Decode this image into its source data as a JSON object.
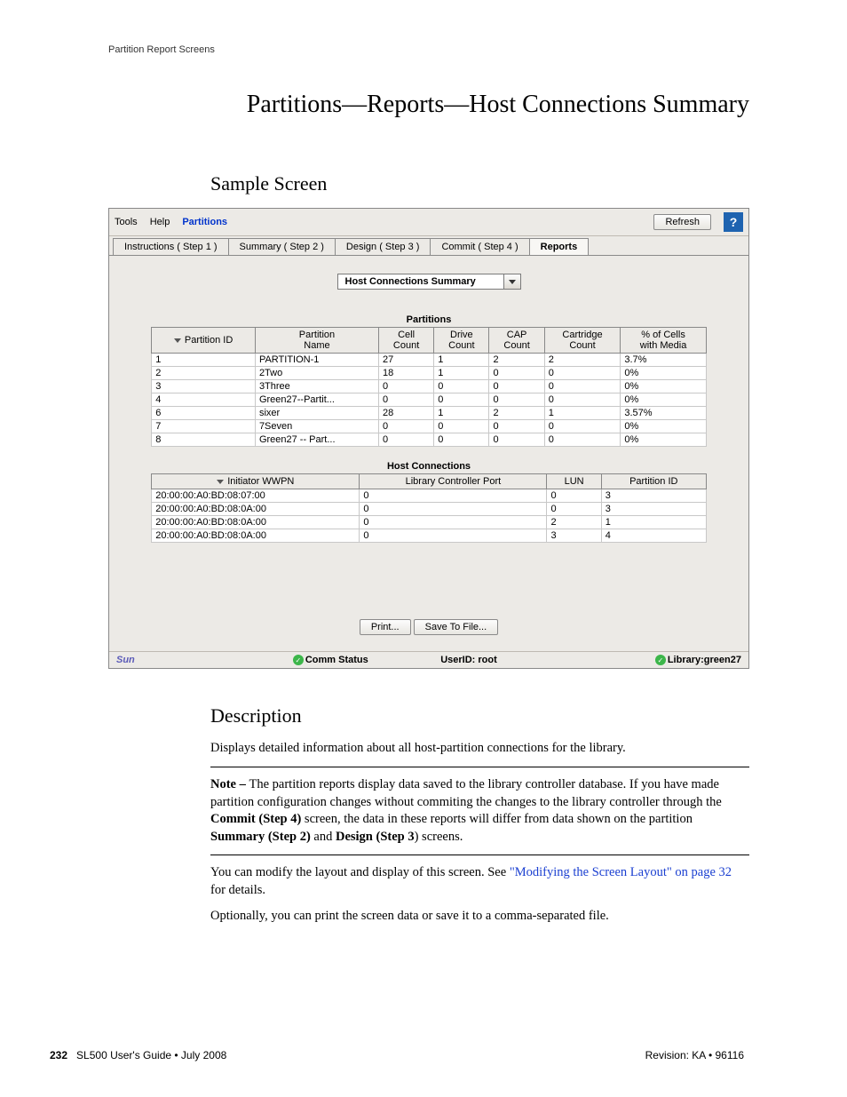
{
  "running_head": "Partition Report Screens",
  "title": "Partitions—Reports—Host Connections Summary",
  "section_sample": "Sample Screen",
  "section_desc": "Description",
  "menubar": {
    "tools": "Tools",
    "help": "Help",
    "partitions": "Partitions",
    "refresh": "Refresh",
    "help_icon": "?"
  },
  "tabs": {
    "step1": "Instructions ( Step 1 )",
    "step2": "Summary ( Step 2 )",
    "step3": "Design ( Step 3 )",
    "step4": "Commit ( Step 4 )",
    "reports": "Reports"
  },
  "dropdown": {
    "value": "Host Connections Summary"
  },
  "partitions_table": {
    "title": "Partitions",
    "headers": {
      "id": "Partition ID",
      "name": "Partition\nName",
      "cell": "Cell\nCount",
      "drive": "Drive\nCount",
      "cap": "CAP\nCount",
      "cart": "Cartridge\nCount",
      "pct": "% of Cells\nwith Media"
    },
    "rows": [
      {
        "id": "1",
        "name": "PARTITION-1",
        "cell": "27",
        "drive": "1",
        "cap": "2",
        "cart": "2",
        "pct": "3.7%"
      },
      {
        "id": "2",
        "name": "2Two",
        "cell": "18",
        "drive": "1",
        "cap": "0",
        "cart": "0",
        "pct": "0%"
      },
      {
        "id": "3",
        "name": "3Three",
        "cell": "0",
        "drive": "0",
        "cap": "0",
        "cart": "0",
        "pct": "0%"
      },
      {
        "id": "4",
        "name": "Green27--Partit...",
        "cell": "0",
        "drive": "0",
        "cap": "0",
        "cart": "0",
        "pct": "0%"
      },
      {
        "id": "6",
        "name": "sixer",
        "cell": "28",
        "drive": "1",
        "cap": "2",
        "cart": "1",
        "pct": "3.57%"
      },
      {
        "id": "7",
        "name": "7Seven",
        "cell": "0",
        "drive": "0",
        "cap": "0",
        "cart": "0",
        "pct": "0%"
      },
      {
        "id": "8",
        "name": "Green27 -- Part...",
        "cell": "0",
        "drive": "0",
        "cap": "0",
        "cart": "0",
        "pct": "0%"
      }
    ]
  },
  "hosts_table": {
    "title": "Host Connections",
    "headers": {
      "wwpn": "Initiator WWPN",
      "port": "Library Controller Port",
      "lun": "LUN",
      "pid": "Partition ID"
    },
    "rows": [
      {
        "wwpn": "20:00:00:A0:BD:08:07:00",
        "port": "0",
        "lun": "0",
        "pid": "3"
      },
      {
        "wwpn": "20:00:00:A0:BD:08:0A:00",
        "port": "0",
        "lun": "0",
        "pid": "3"
      },
      {
        "wwpn": "20:00:00:A0:BD:08:0A:00",
        "port": "0",
        "lun": "2",
        "pid": "1"
      },
      {
        "wwpn": "20:00:00:A0:BD:08:0A:00",
        "port": "0",
        "lun": "3",
        "pid": "4"
      }
    ]
  },
  "actions": {
    "print": "Print...",
    "save": "Save To File..."
  },
  "statusbar": {
    "logo": "Sun",
    "comm": "Comm Status",
    "user": "UserID: root",
    "library": "Library:green27"
  },
  "description": {
    "p1": "Displays detailed information about all host-partition connections for the library.",
    "note_prefix": "Note – ",
    "note_body_1": "The partition reports display data saved to the library controller database. If you have made partition configuration changes without commiting the changes to the library controller through the ",
    "note_b1": "Commit (Step 4)",
    "note_body_2": " screen, the data in these reports will differ from data shown on the partition ",
    "note_b2": "Summary (Step 2)",
    "note_and": " and ",
    "note_b3": "Design (Step 3",
    "note_body_3": ") screens.",
    "p2a": "You can modify the layout and display of this screen. See ",
    "p2_link": "\"Modifying the Screen Layout\" on page 32",
    "p2b": " for details.",
    "p3": "Optionally, you can print the screen data or save it to a comma-separated file."
  },
  "footer": {
    "page": "232",
    "guide": "SL500 User's Guide  •  July 2008",
    "rev": "Revision: KA  •  96116"
  }
}
